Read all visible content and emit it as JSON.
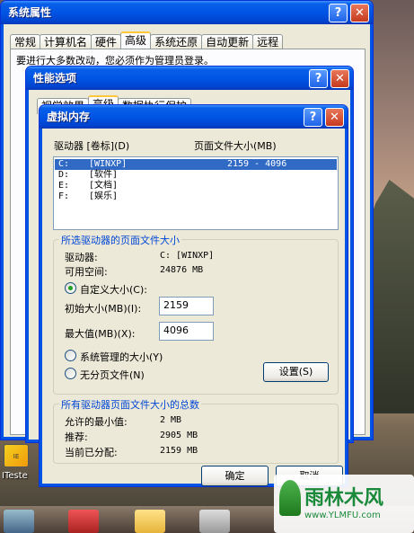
{
  "system_props": {
    "title": "系统属性",
    "tabs": [
      "常规",
      "计算机名",
      "硬件",
      "高级",
      "系统还原",
      "自动更新",
      "远程"
    ],
    "partial_text": "要进行大多数改动，您必须作为管理员登录。"
  },
  "perf": {
    "title": "性能选项",
    "tabs": [
      "视觉效果",
      "高级",
      "数据执行保护"
    ]
  },
  "vm": {
    "title": "虚拟内存",
    "col_drive": "驱动器 [卷标](D)",
    "col_size": "页面文件大小(MB)",
    "drives": [
      {
        "drive": "C:",
        "label": "[WINXP]",
        "size": "2159 - 4096",
        "selected": true
      },
      {
        "drive": "D:",
        "label": "[软件]",
        "size": ""
      },
      {
        "drive": "E:",
        "label": "[文档]",
        "size": ""
      },
      {
        "drive": "F:",
        "label": "[娱乐]",
        "size": ""
      }
    ],
    "sel_group": "所选驱动器的页面文件大小",
    "drive_label": "驱动器:",
    "drive_value": "C: [WINXP]",
    "free_label": "可用空间:",
    "free_value": "24876 MB",
    "custom_label": "自定义大小(C):",
    "initial_label": "初始大小(MB)(I):",
    "initial_value": "2159",
    "max_label": "最大值(MB)(X):",
    "max_value": "4096",
    "system_label": "系统管理的大小(Y)",
    "nopage_label": "无分页文件(N)",
    "set_btn": "设置(S)",
    "total_group": "所有驱动器页面文件大小的总数",
    "min_label": "允许的最小值:",
    "min_value": "2 MB",
    "rec_label": "推荐:",
    "rec_value": "2905 MB",
    "cur_label": "当前已分配:",
    "cur_value": "2159 MB",
    "ok_btn": "确定",
    "cancel_btn": "取消"
  },
  "desktop": {
    "icon_caption": "ITeste",
    "watermark_title": "雨林木风",
    "watermark_url": "www.YLMFU.com"
  }
}
